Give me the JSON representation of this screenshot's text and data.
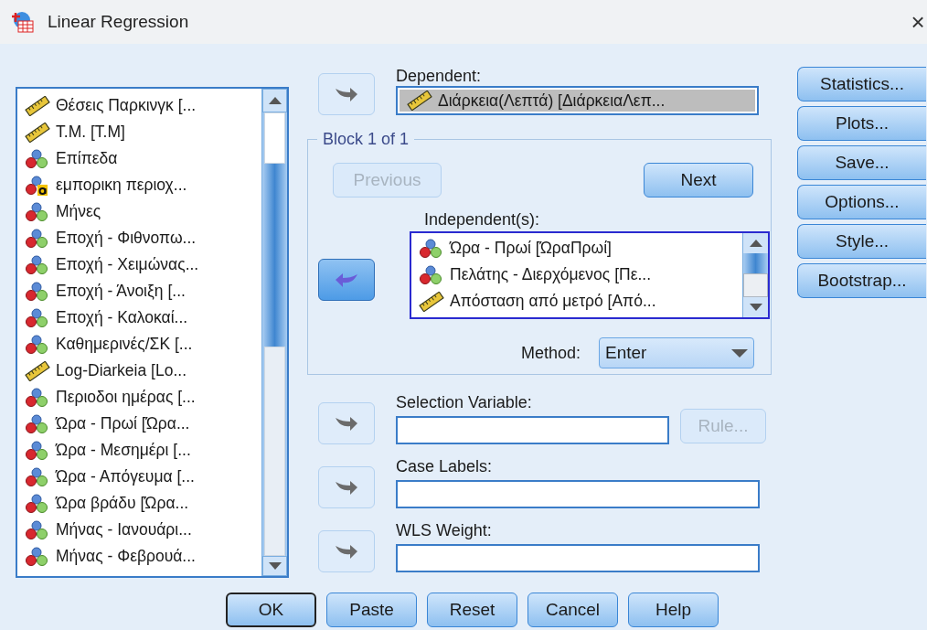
{
  "window": {
    "title": "Linear Regression",
    "close": "×"
  },
  "variables": [
    {
      "name": "Θέσεις Παρκινγκ [...",
      "kind": "scale"
    },
    {
      "name": "Τ.Μ. [Τ.Μ]",
      "kind": "scale"
    },
    {
      "name": "Επίπεδα",
      "kind": "nominal"
    },
    {
      "name": "εμπορικη περιοχ...",
      "kind": "nominal-string"
    },
    {
      "name": "Μήνες",
      "kind": "nominal"
    },
    {
      "name": "Εποχή - Φιθνοπω...",
      "kind": "nominal"
    },
    {
      "name": "Εποχή - Χειμώνας...",
      "kind": "nominal"
    },
    {
      "name": "Εποχή - Άνοιξη  [...",
      "kind": "nominal"
    },
    {
      "name": "Εποχή - Καλοκαί...",
      "kind": "nominal"
    },
    {
      "name": "Καθημερινές/ΣΚ [...",
      "kind": "nominal"
    },
    {
      "name": "Log-Diarkeia [Lo...",
      "kind": "scale"
    },
    {
      "name": "Περιοδοι ημέρας [...",
      "kind": "nominal"
    },
    {
      "name": "Ώρα - Πρωί [Ώρα...",
      "kind": "nominal"
    },
    {
      "name": "Ώρα - Μεσημέρι [...",
      "kind": "nominal"
    },
    {
      "name": "Ώρα - Απόγευμα [...",
      "kind": "nominal"
    },
    {
      "name": "Ώρα βράδυ [Ώρα...",
      "kind": "nominal"
    },
    {
      "name": "Μήνας - Ιανουάρι...",
      "kind": "nominal"
    },
    {
      "name": "Μήνας - Φεβρουά...",
      "kind": "nominal"
    }
  ],
  "dependent": {
    "label": "Dependent:",
    "move_button": {
      "kind": "right",
      "enabled": false
    },
    "value": {
      "name": "Διάρκεια(Λεπτά) [ΔιάρκειαΛεπ...",
      "kind": "scale",
      "selected": true
    }
  },
  "block": {
    "title": "Block 1 of 1",
    "previous": {
      "label": "Previous",
      "disabled": true
    },
    "next": {
      "label": "Next",
      "disabled": false
    },
    "independents": {
      "label": "Independent(s):",
      "move_button": {
        "kind": "left",
        "enabled": true
      },
      "items": [
        {
          "name": "Ώρα - Πρωί [ΏραΠρωί]",
          "kind": "nominal",
          "selected": false
        },
        {
          "name": "Πελάτης - Διερχόμενος [Πε...",
          "kind": "nominal",
          "selected": false
        },
        {
          "name": "Απόσταση από μετρό [Από...",
          "kind": "scale",
          "selected": false
        }
      ]
    },
    "method": {
      "label": "Method:",
      "value": "Enter"
    }
  },
  "selection_variable": {
    "label": "Selection Variable:",
    "move_button": {
      "kind": "right",
      "enabled": false
    },
    "rule": {
      "label": "Rule...",
      "disabled": true
    }
  },
  "case_labels": {
    "label": "Case Labels:",
    "move_button": {
      "kind": "right",
      "enabled": false
    }
  },
  "wls_weight": {
    "label": "WLS Weight:",
    "move_button": {
      "kind": "right",
      "enabled": false
    }
  },
  "side_buttons": [
    {
      "label": "Statistics..."
    },
    {
      "label": "Plots..."
    },
    {
      "label": "Save..."
    },
    {
      "label": "Options..."
    },
    {
      "label": "Style..."
    },
    {
      "label": "Bootstrap..."
    }
  ],
  "footer_buttons": [
    {
      "label": "OK",
      "default": true
    },
    {
      "label": "Paste",
      "default": false
    },
    {
      "label": "Reset",
      "default": false
    },
    {
      "label": "Cancel",
      "default": false
    },
    {
      "label": "Help",
      "default": false
    }
  ]
}
